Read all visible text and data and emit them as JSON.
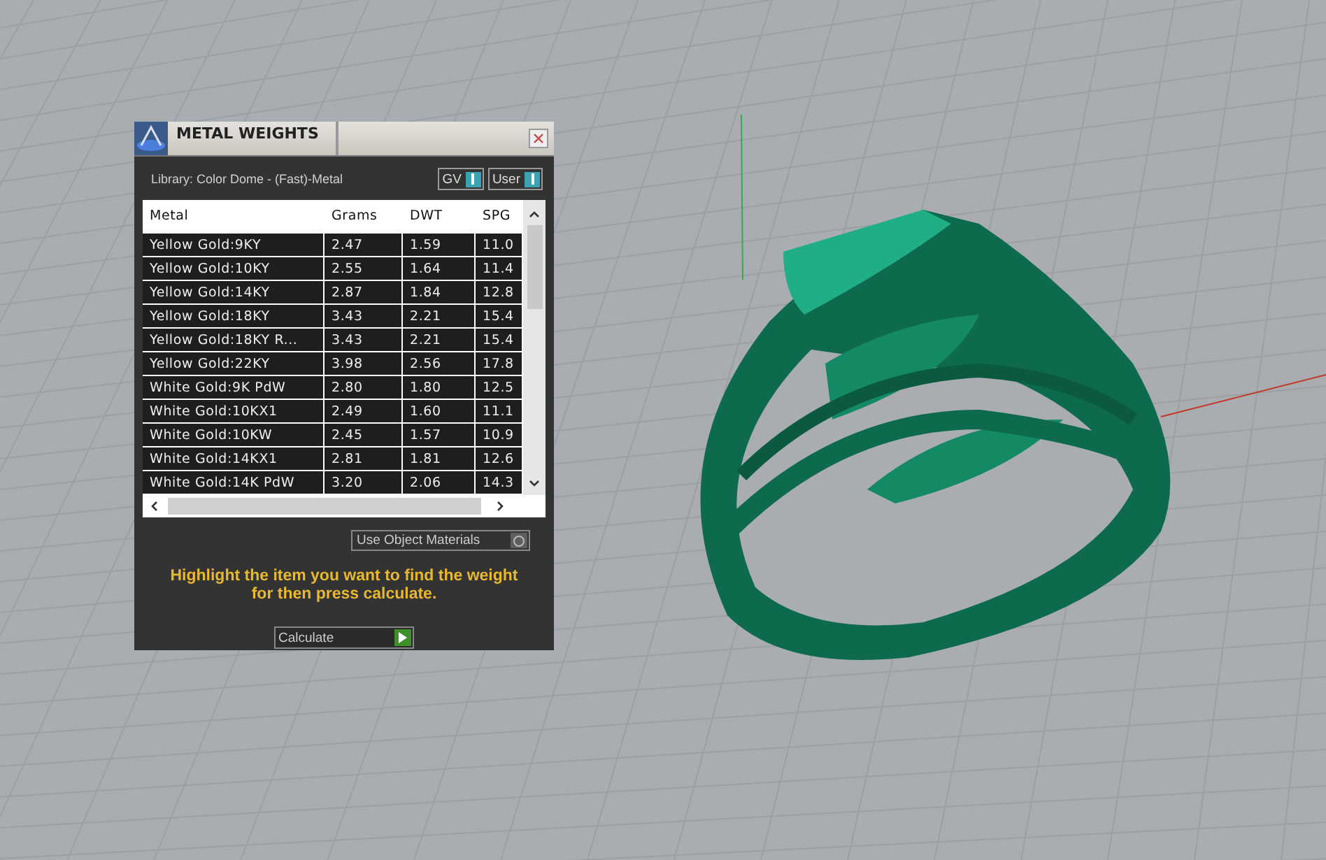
{
  "window": {
    "title": "METAL WEIGHTS"
  },
  "library": "Library: Color Dome - (Fast)-Metal",
  "toggles": [
    {
      "label": "GV",
      "on": true
    },
    {
      "label": "User",
      "on": true
    }
  ],
  "table": {
    "columns": [
      "Metal",
      "Grams",
      "DWT",
      "SPG"
    ],
    "rows": [
      [
        "Yellow Gold:9KY",
        "2.47",
        "1.59",
        "11.0"
      ],
      [
        "Yellow Gold:10KY",
        "2.55",
        "1.64",
        "11.4"
      ],
      [
        "Yellow Gold:14KY",
        "2.87",
        "1.84",
        "12.8"
      ],
      [
        "Yellow Gold:18KY",
        "3.43",
        "2.21",
        "15.4"
      ],
      [
        "Yellow Gold:18KY R...",
        "3.43",
        "2.21",
        "15.4"
      ],
      [
        "Yellow Gold:22KY",
        "3.98",
        "2.56",
        "17.8"
      ],
      [
        "White Gold:9K PdW",
        "2.80",
        "1.80",
        "12.5"
      ],
      [
        "White Gold:10KX1",
        "2.49",
        "1.60",
        "11.1"
      ],
      [
        "White Gold:10KW",
        "2.45",
        "1.57",
        "10.9"
      ],
      [
        "White Gold:14KX1",
        "2.81",
        "1.81",
        "12.6"
      ],
      [
        "White Gold:14K PdW",
        "3.20",
        "2.06",
        "14.3"
      ]
    ]
  },
  "use_object_materials": {
    "label": "Use Object Materials",
    "on": false
  },
  "hint": "Highlight the item you want to find the weight for then press calculate.",
  "calculate_button": "Calculate"
}
